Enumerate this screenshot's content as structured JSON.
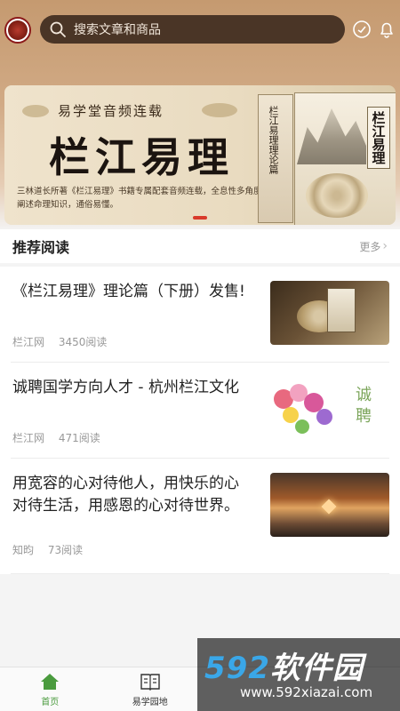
{
  "header": {
    "search_placeholder": "搜索文章和商品"
  },
  "banner": {
    "subtitle": "易学堂音频连载",
    "title": "栏江易理",
    "description": "三林道长所著《栏江易理》书籍专属配套音频连载，全息性多角度阐述命理知识，通俗易懂。",
    "book_cover_title": "栏江易理",
    "book_spine_title": "栏江易理理论篇"
  },
  "section": {
    "title": "推荐阅读",
    "more_label": "更多"
  },
  "articles": [
    {
      "title": "《栏江易理》理论篇（下册）发售!",
      "source": "栏江网",
      "reads": "3450阅读"
    },
    {
      "title": "诚聘国学方向人才 - 杭州栏江文化",
      "source": "栏江网",
      "reads": "471阅读",
      "thumb_text": "诚聘"
    },
    {
      "title": "用宽容的心对待他人，用快乐的心对待生活，用感恩的心对待世界。",
      "source": "知昀",
      "reads": "73阅读"
    }
  ],
  "tabbar": {
    "items": [
      {
        "label": "首页",
        "icon": "home-icon",
        "active": true
      },
      {
        "label": "易学园地",
        "icon": "book-icon",
        "active": false
      }
    ]
  },
  "watermark": {
    "brand_num": "592",
    "brand_text": "软件园",
    "url": "www.592xiazai.com"
  },
  "colors": {
    "accent_green": "#4a9b3e",
    "search_bg": "#4a3526",
    "banner_dot": "#d93a2b"
  }
}
